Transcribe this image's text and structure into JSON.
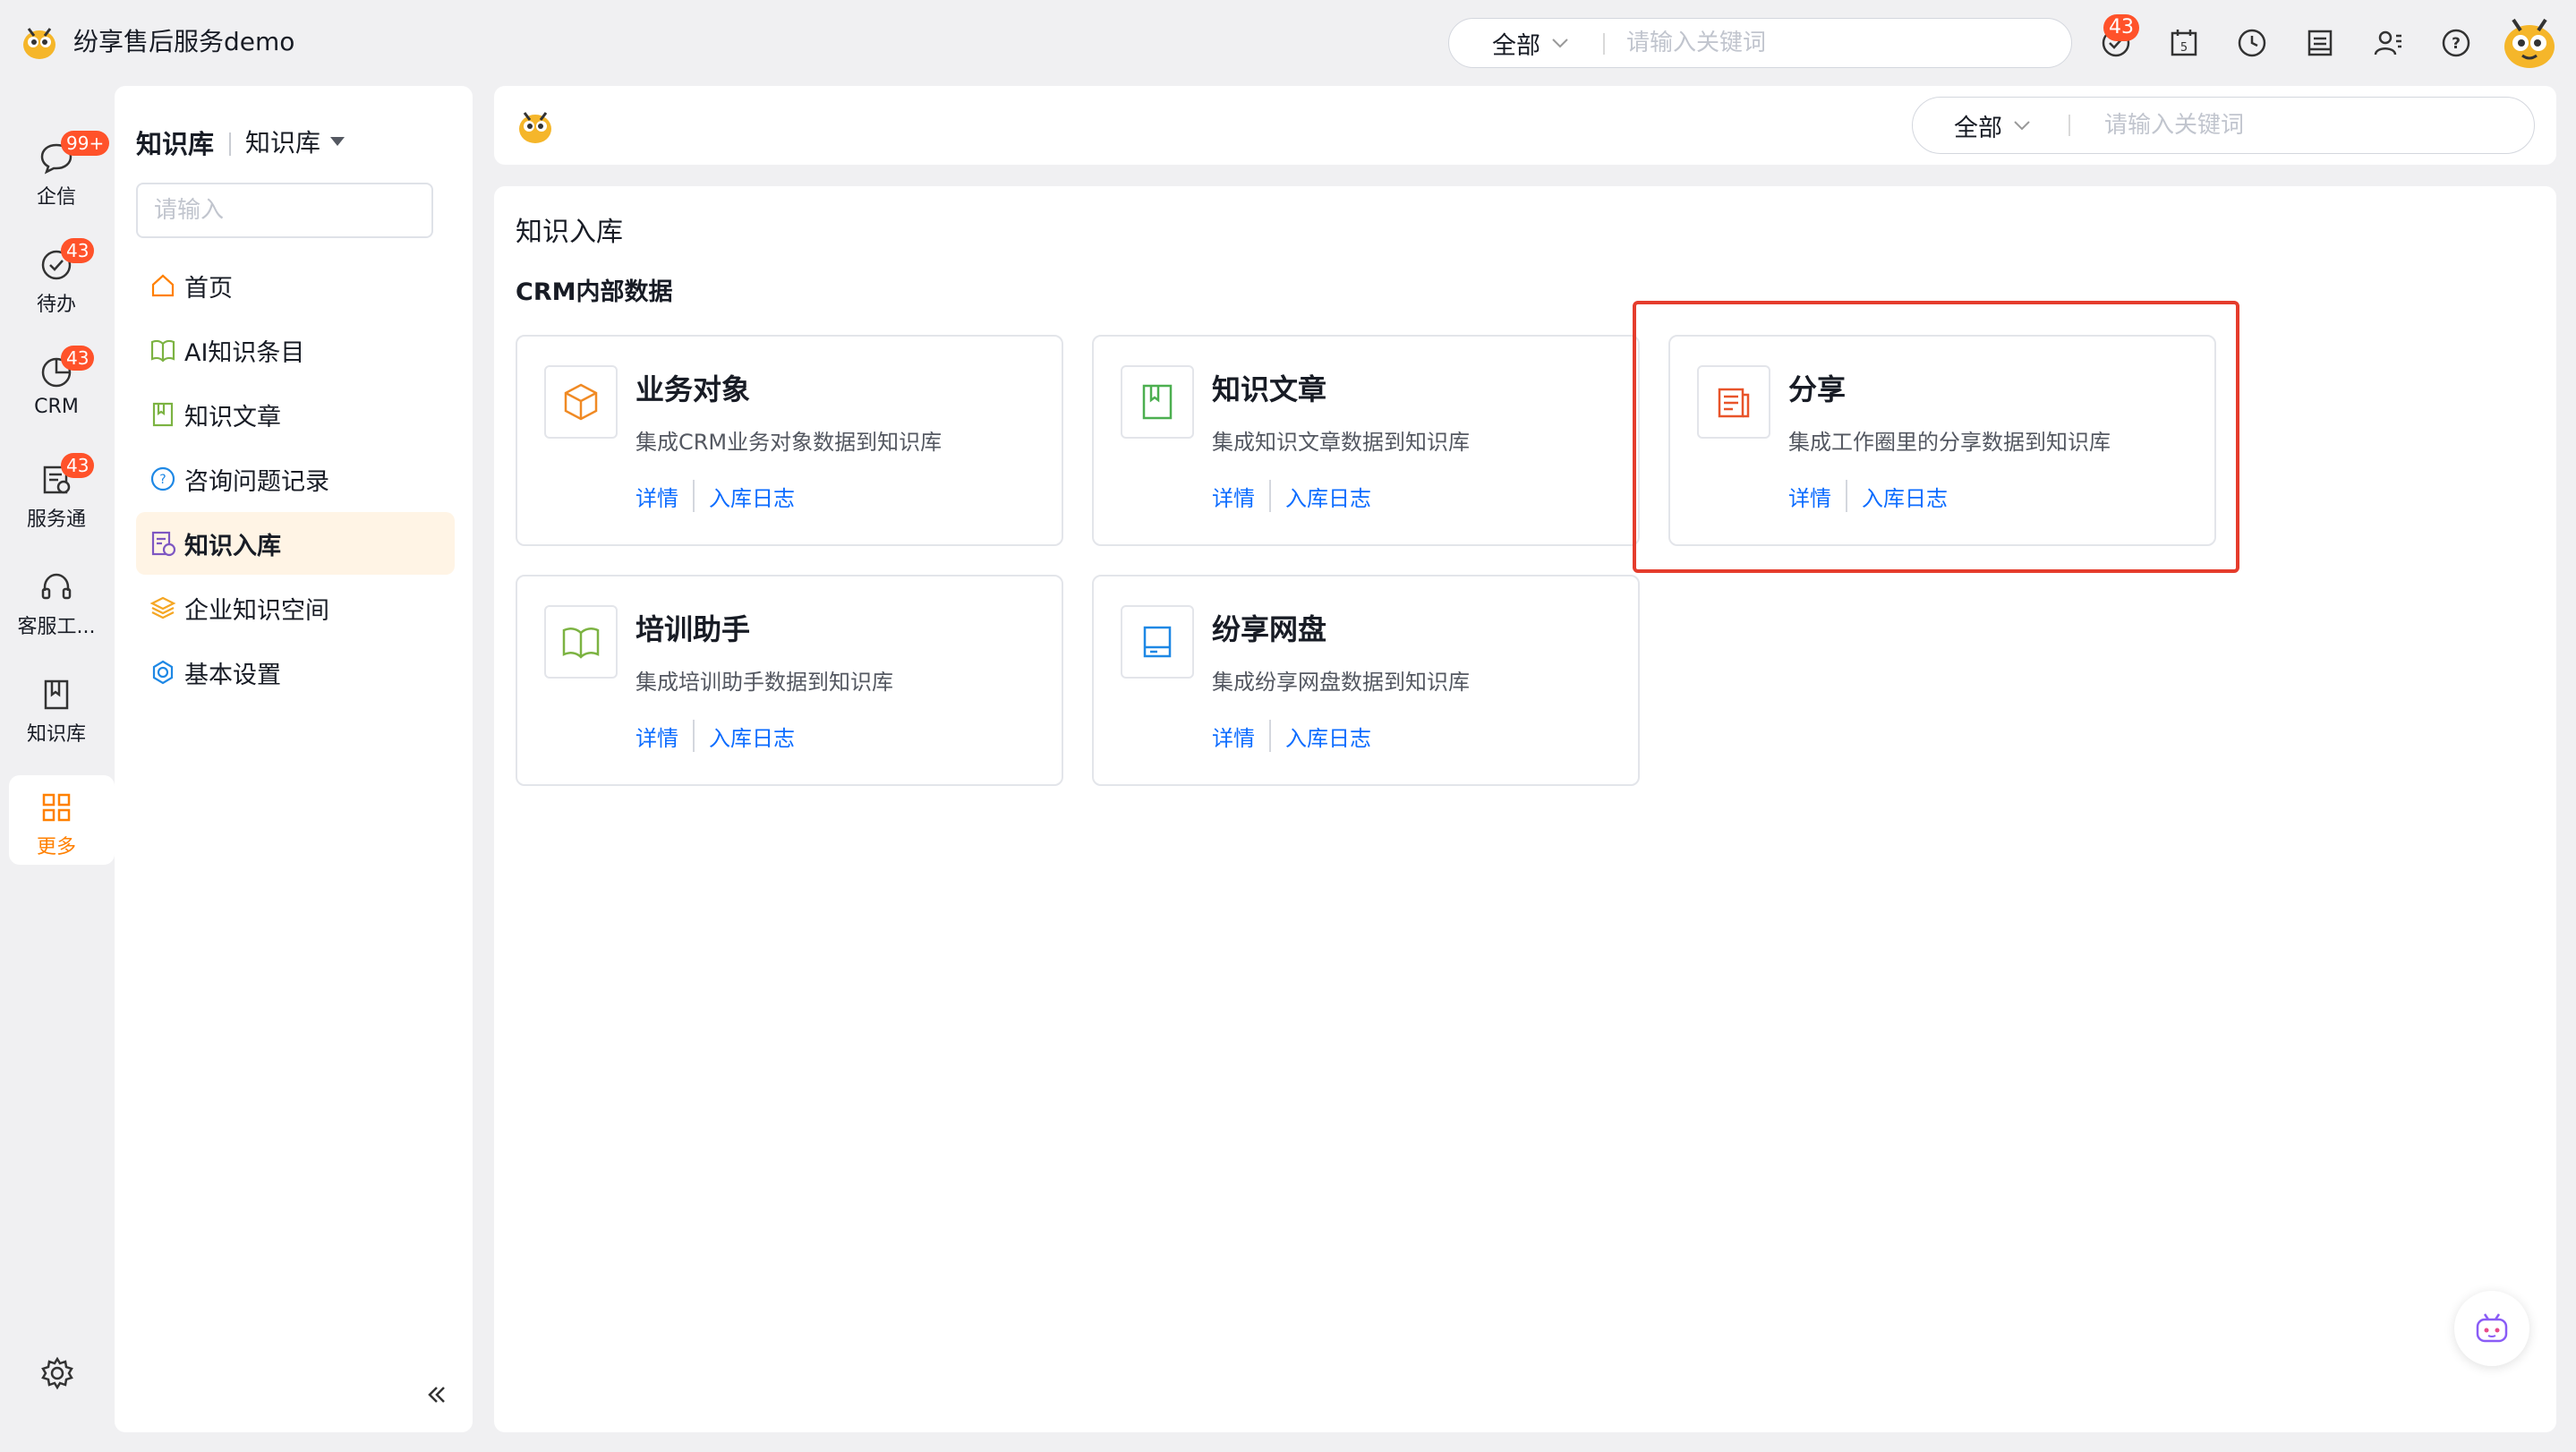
{
  "app": {
    "title": "纷享售后服务demo"
  },
  "global_search": {
    "scope": "全部",
    "placeholder": "请输入关键词"
  },
  "topbar": {
    "todo_badge": "43"
  },
  "rail": {
    "items": [
      {
        "label": "企信",
        "icon": "chat-icon",
        "badge": "99+"
      },
      {
        "label": "待办",
        "icon": "check-circle-icon",
        "badge": "43"
      },
      {
        "label": "CRM",
        "icon": "pie-chart-icon",
        "badge": "43"
      },
      {
        "label": "服务通",
        "icon": "service-icon",
        "badge": "43"
      },
      {
        "label": "客服工...",
        "icon": "headset-icon"
      },
      {
        "label": "知识库",
        "icon": "book-icon"
      },
      {
        "label": "更多",
        "icon": "grid-icon"
      }
    ]
  },
  "sidebar": {
    "title": "知识库",
    "subtitle": "知识库",
    "search_placeholder": "请输入",
    "items": [
      {
        "label": "首页",
        "icon": "home-icon"
      },
      {
        "label": "AI知识条目",
        "icon": "open-book-icon"
      },
      {
        "label": "知识文章",
        "icon": "article-icon"
      },
      {
        "label": "咨询问题记录",
        "icon": "question-icon"
      },
      {
        "label": "知识入库",
        "icon": "import-icon",
        "active": true
      },
      {
        "label": "企业知识空间",
        "icon": "layers-icon"
      },
      {
        "label": "基本设置",
        "icon": "settings-icon"
      }
    ]
  },
  "header_search": {
    "scope": "全部",
    "placeholder": "请输入关键词"
  },
  "main": {
    "title": "知识入库",
    "section": "CRM内部数据",
    "cards": [
      {
        "title": "业务对象",
        "desc": "集成CRM业务对象数据到知识库",
        "link1": "详情",
        "link2": "入库日志",
        "icon": "cube-icon"
      },
      {
        "title": "知识文章",
        "desc": "集成知识文章数据到知识库",
        "link1": "详情",
        "link2": "入库日志",
        "icon": "article-icon"
      },
      {
        "title": "分享",
        "desc": "集成工作圈里的分享数据到知识库",
        "link1": "详情",
        "link2": "入库日志",
        "icon": "share-doc-icon"
      },
      {
        "title": "培训助手",
        "desc": "集成培训助手数据到知识库",
        "link1": "详情",
        "link2": "入库日志",
        "icon": "open-book-icon"
      },
      {
        "title": "纷享网盘",
        "desc": "集成纷享网盘数据到知识库",
        "link1": "详情",
        "link2": "入库日志",
        "icon": "drive-icon"
      }
    ]
  },
  "colors": {
    "accent": "#ff8000",
    "link": "#0c6cff",
    "badge": "#ff522a",
    "highlight": "#e53c2c"
  }
}
